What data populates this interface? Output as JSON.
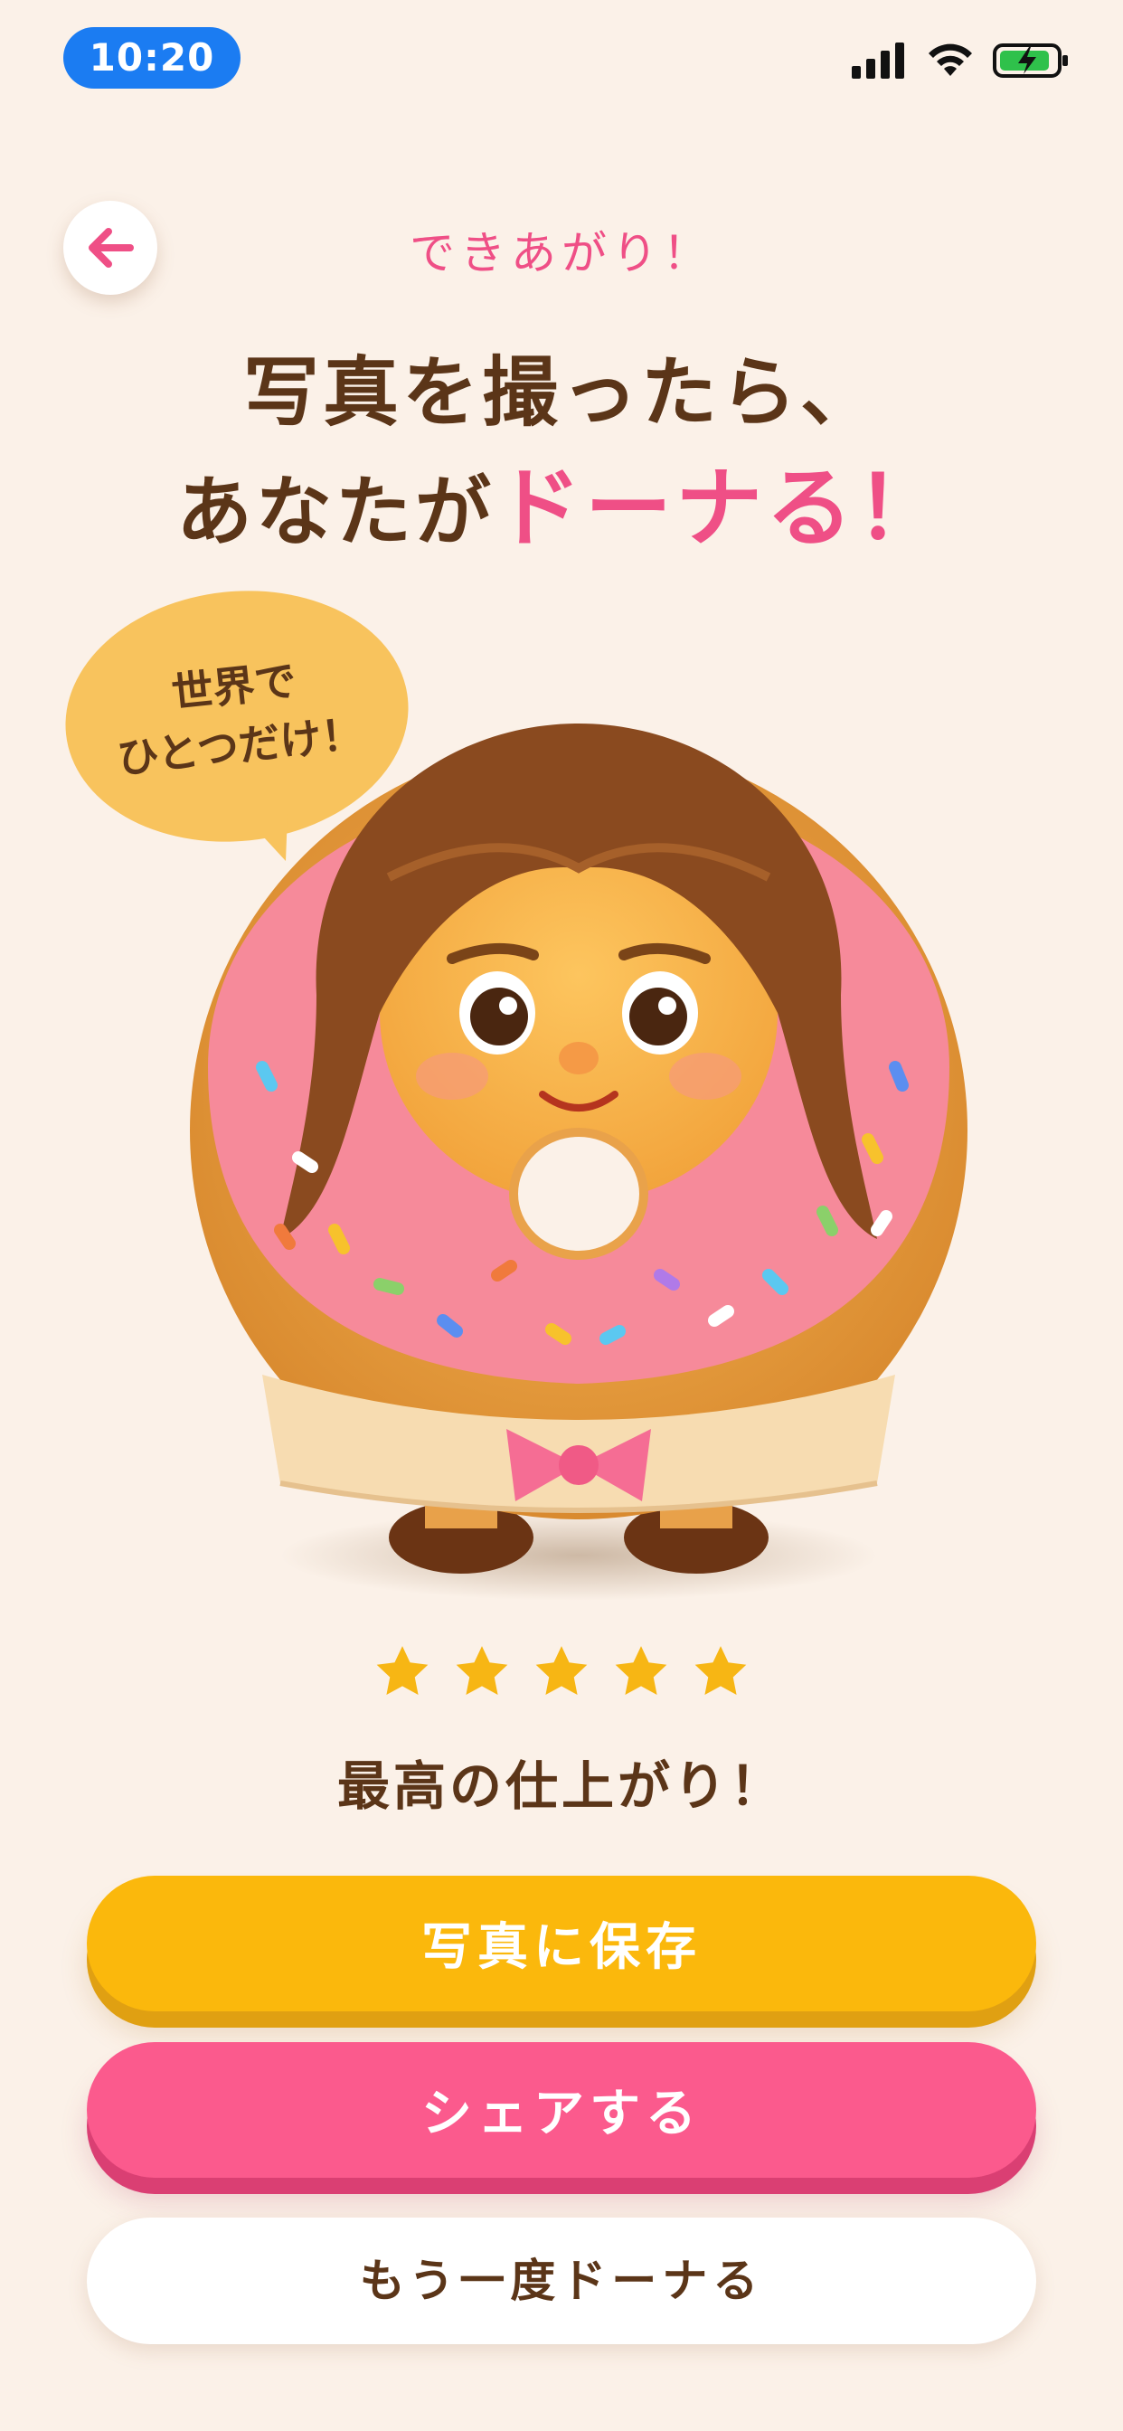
{
  "status_bar": {
    "time": "10:20",
    "icons": [
      "cellular-signal-icon",
      "wifi-icon",
      "battery-charging-icon"
    ]
  },
  "header": {
    "back_icon": "arrow-left-icon",
    "label": "できあがり！",
    "headline_line1": "写真を撮ったら、",
    "headline_line2_prefix": "あなたが",
    "headline_line2_accent": "ドーナる！"
  },
  "bubble": {
    "line1": "世界で",
    "line2": "ひとつだけ！"
  },
  "rating": {
    "stars": 5,
    "max_stars": 5,
    "text": "最高の仕上がり！"
  },
  "actions": {
    "save_label": "写真に保存",
    "share_label": "シェアする",
    "again_label": "もう一度ドーナる"
  },
  "colors": {
    "background": "#fbf1e8",
    "accent_pink": "#ef4f86",
    "brown_text": "#5b3518",
    "save_button": "#fbb80c",
    "share_button": "#fb5a8d",
    "status_pill": "#1b7cf2",
    "star": "#f7b614"
  }
}
